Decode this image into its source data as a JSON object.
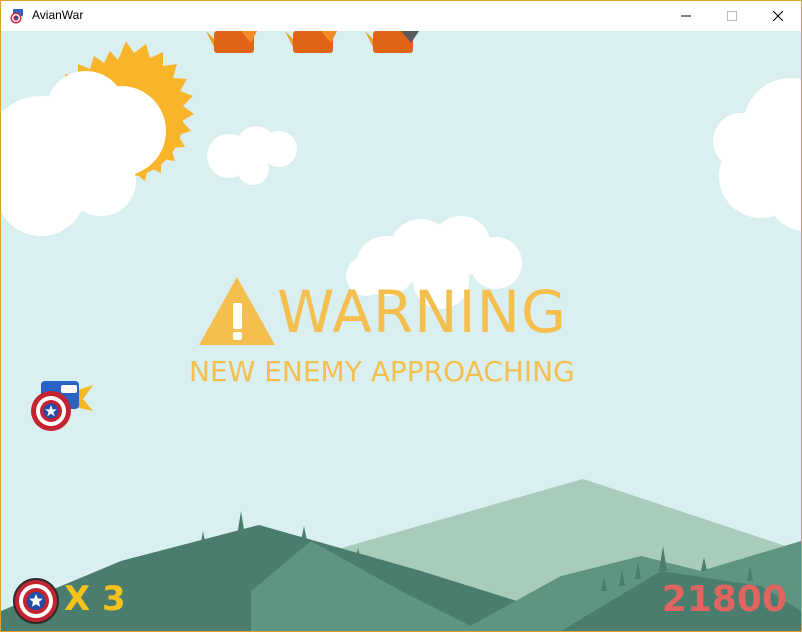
{
  "window": {
    "title": "AvianWar",
    "app_icon": "captain-shield-icon",
    "controls": [
      "minimize-icon",
      "maximize-icon",
      "close-icon"
    ]
  },
  "hud": {
    "lives_label": "X 3",
    "lives": 3,
    "lives_icon": "captain-shield-icon",
    "score": "21800"
  },
  "banner": {
    "icon": "warning-triangle-icon",
    "title": "WARNING",
    "subtitle": "NEW ENEMY APPROACHING"
  },
  "scene": {
    "player": "captain-bird",
    "enemies_visible": 3,
    "colors": {
      "sky": "#d9eff0",
      "sun": "#f9b52a",
      "warning": "#f4bf4f",
      "score": "#e0645f",
      "lives": "#f7c21c",
      "hill_dark": "#4a7d6d",
      "hill_mid": "#5e9480",
      "hill_light": "#a9cbbb"
    }
  }
}
